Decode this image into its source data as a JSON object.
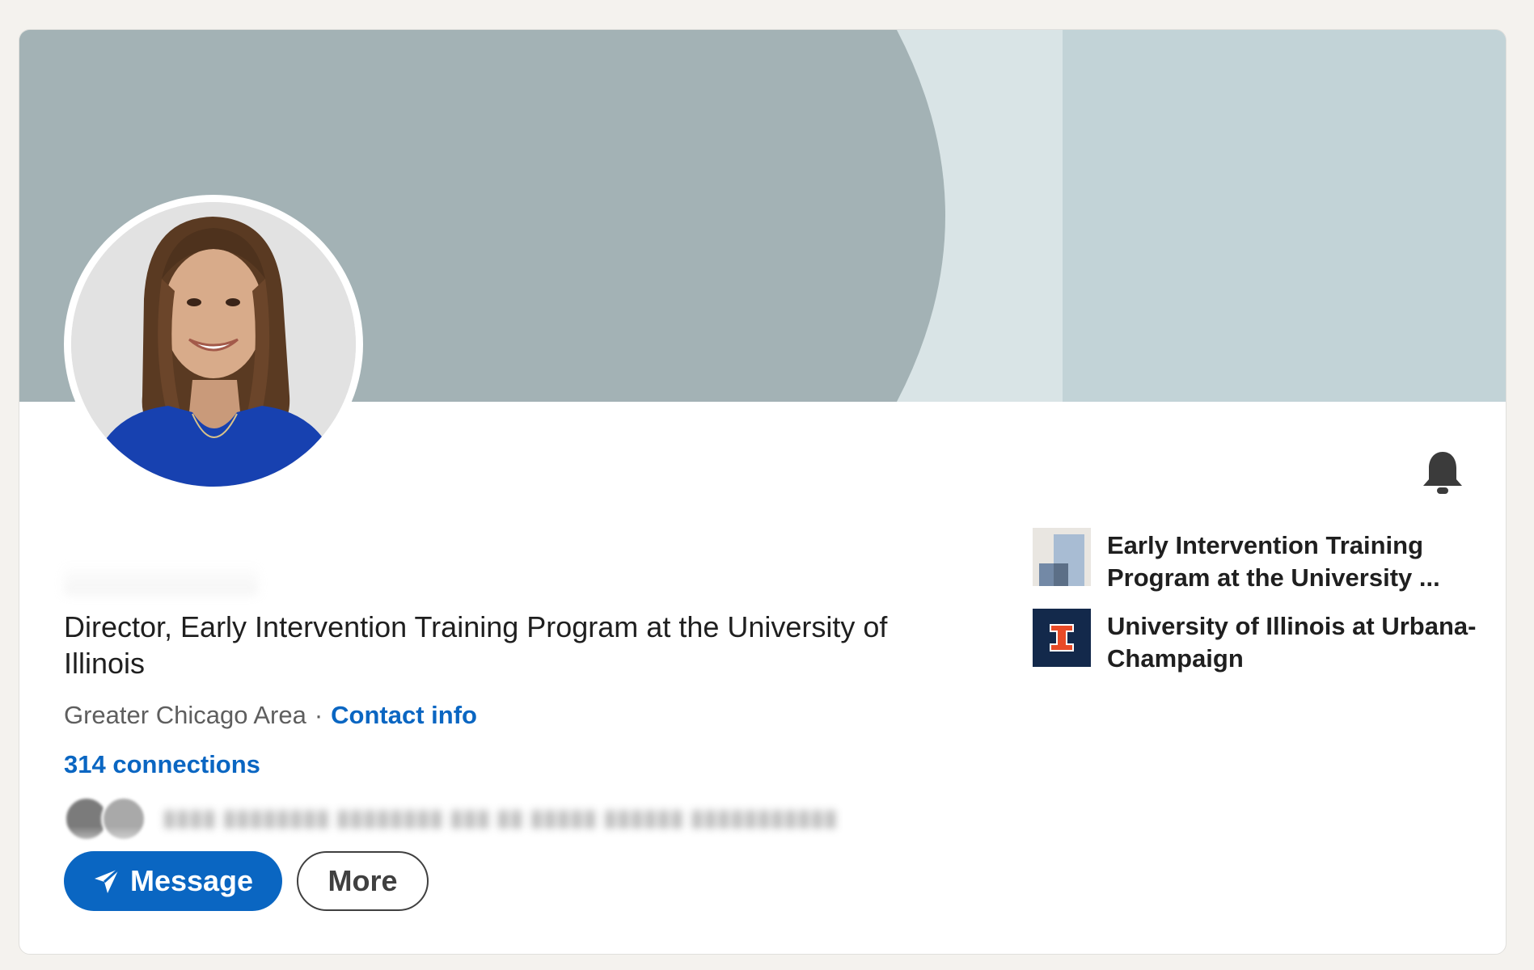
{
  "profile": {
    "headline": "Director, Early Intervention Training Program at the University of Illinois",
    "location": "Greater Chicago Area",
    "separator": "·",
    "contact_info_label": "Contact info",
    "connections_label": "314 connections"
  },
  "actions": {
    "message_label": "Message",
    "more_label": "More"
  },
  "organizations": [
    {
      "name": "Early Intervention Training Program at the University ...",
      "icon": "company-logo-icon"
    },
    {
      "name": "University of Illinois at Urbana-Champaign",
      "icon": "illinois-i-logo-icon"
    }
  ],
  "colors": {
    "accent": "#0a66c2",
    "cover_dark": "#a3b2b5",
    "cover_mid": "#d9e4e6",
    "cover_light": "#c2d3d7",
    "illinois_navy": "#13294b",
    "illinois_orange": "#e84a27"
  }
}
